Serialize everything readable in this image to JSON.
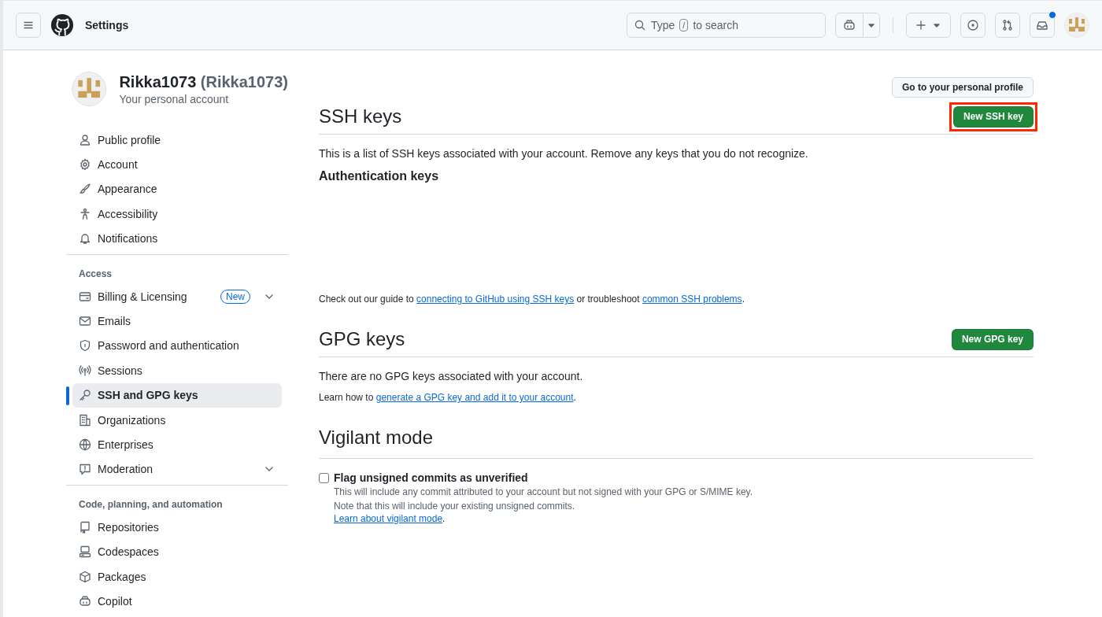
{
  "header": {
    "title": "Settings",
    "search": {
      "placeholder_start": "Type",
      "shortcut": "/",
      "placeholder_end": "to search"
    },
    "inbox_unread": true
  },
  "profile": {
    "name": "Rikka1073",
    "handle": "(Rikka1073)",
    "subtitle": "Your personal account",
    "profile_button": "Go to your personal profile"
  },
  "sidebar": {
    "groups": [
      {
        "items": [
          {
            "label": "Public profile",
            "selected": false
          },
          {
            "label": "Account",
            "selected": false
          },
          {
            "label": "Appearance",
            "selected": false
          },
          {
            "label": "Accessibility",
            "selected": false
          },
          {
            "label": "Notifications",
            "selected": false
          }
        ]
      },
      {
        "heading": "Access",
        "items": [
          {
            "label": "Billing & Licensing",
            "selected": false,
            "badge": "New",
            "expanded": false
          },
          {
            "label": "Emails",
            "selected": false
          },
          {
            "label": "Password and authentication",
            "selected": false
          },
          {
            "label": "Sessions",
            "selected": false
          },
          {
            "label": "SSH and GPG keys",
            "selected": true
          },
          {
            "label": "Organizations",
            "selected": false
          },
          {
            "label": "Enterprises",
            "selected": false
          },
          {
            "label": "Moderation",
            "selected": false,
            "expanded": false
          }
        ]
      },
      {
        "heading": "Code, planning, and automation",
        "items": [
          {
            "label": "Repositories",
            "selected": false
          },
          {
            "label": "Codespaces",
            "selected": false
          },
          {
            "label": "Packages",
            "selected": false
          },
          {
            "label": "Copilot",
            "selected": false
          }
        ]
      }
    ]
  },
  "sections": [
    {
      "title": "SSH keys",
      "button": {
        "label": "New SSH key",
        "highlighted": true
      },
      "blocks": [
        {
          "kind": "text",
          "text": "This is a list of SSH keys associated with your account. Remove any keys that you do not recognize."
        },
        {
          "kind": "subheading",
          "text": "Authentication keys"
        },
        {
          "kind": "spacer"
        },
        {
          "kind": "note",
          "parts": [
            {
              "text": "Check out our guide to "
            },
            {
              "text": "connecting to GitHub using SSH keys",
              "link": true
            },
            {
              "text": " or troubleshoot "
            },
            {
              "text": "common SSH problems",
              "link": true
            },
            {
              "text": "."
            }
          ]
        }
      ]
    },
    {
      "title": "GPG keys",
      "button": {
        "label": "New GPG key",
        "highlighted": false
      },
      "blocks": [
        {
          "kind": "text",
          "text": "There are no GPG keys associated with your account."
        },
        {
          "kind": "note",
          "parts": [
            {
              "text": "Learn how to "
            },
            {
              "text": "generate a GPG key and add it to your account",
              "link": true
            },
            {
              "text": "."
            }
          ]
        }
      ]
    },
    {
      "title": "Vigilant mode",
      "blocks": [
        {
          "kind": "checkbox",
          "label": "Flag unsigned commits as unverified",
          "checked": false,
          "lines": [
            "This will include any commit attributed to your account but not signed with your GPG or S/MIME key.",
            "Note that this will include your existing unsigned commits."
          ],
          "parts": [
            {
              "text": "Learn about vigilant mode",
              "link": true
            },
            {
              "text": "."
            }
          ]
        }
      ]
    }
  ]
}
